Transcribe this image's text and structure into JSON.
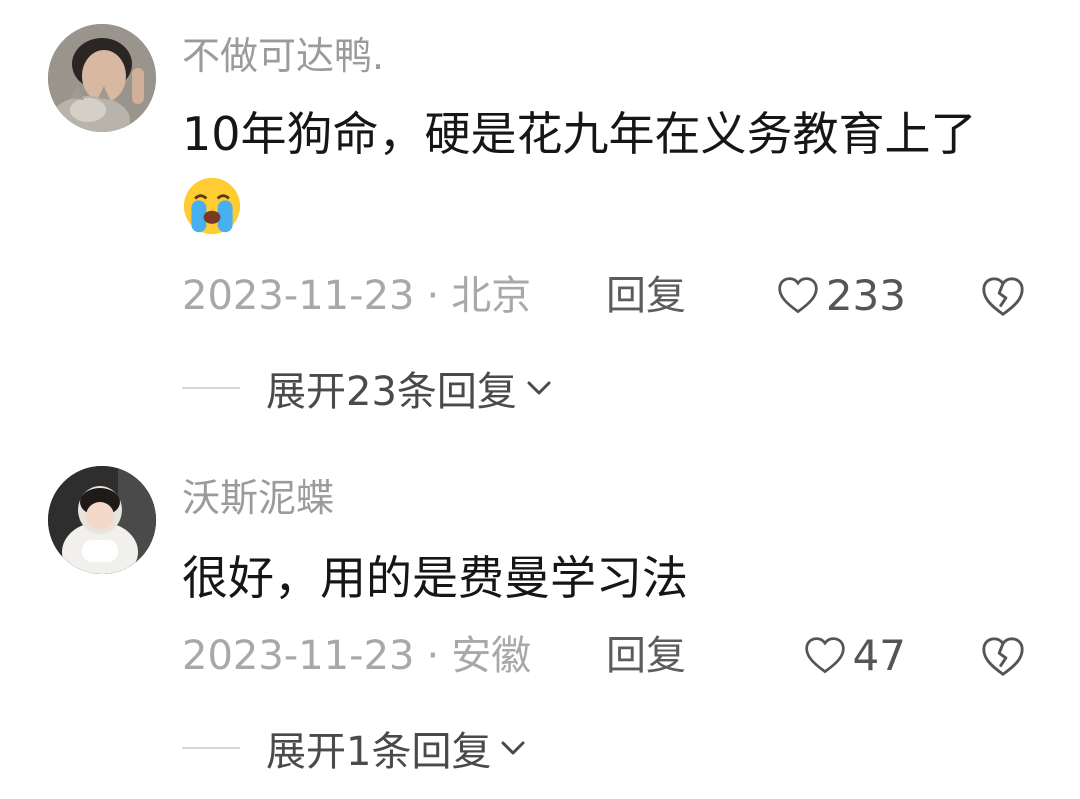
{
  "comments": [
    {
      "username": "不做可达鸭.",
      "text": "10年狗命，硬是花九年在义务教育上了",
      "emoji": "loudly-crying-face",
      "date": "2023-11-23",
      "location": "北京",
      "reply_label": "回复",
      "likes": "233",
      "expand_label": "展开23条回复"
    },
    {
      "username": "沃斯泥蝶",
      "text": "很好，用的是费曼学习法",
      "date": "2023-11-23",
      "location": "安徽",
      "reply_label": "回复",
      "likes": "47",
      "expand_label": "展开1条回复"
    }
  ],
  "separator": "·",
  "colors": {
    "username": "#9b9b9b",
    "text": "#161616",
    "meta": "#a8a8a8",
    "reply": "#5c5c5c",
    "expand": "#4a4a4a"
  }
}
